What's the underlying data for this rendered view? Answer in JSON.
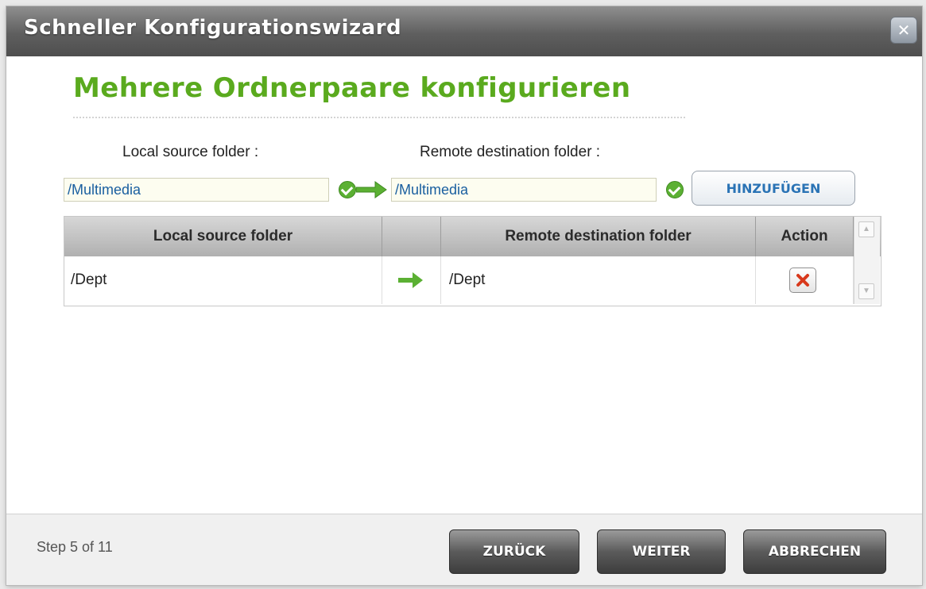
{
  "window": {
    "title": "Schneller Konfigurationswizard",
    "close_icon": "close-icon"
  },
  "page": {
    "heading": "Mehrere Ordnerpaare konfigurieren"
  },
  "form": {
    "local_label": "Local source folder :",
    "remote_label": "Remote destination folder :",
    "local_value": "/Multimedia",
    "remote_value": "/Multimedia",
    "add_button": "HINZUFÜGEN"
  },
  "table": {
    "columns": [
      "Local source folder",
      "",
      "Remote destination folder",
      "Action"
    ],
    "rows": [
      {
        "local": "/Dept",
        "remote": "/Dept",
        "action_icon": "delete-icon"
      }
    ]
  },
  "footer": {
    "step": "Step 5 of 11",
    "back": "ZURÜCK",
    "next": "WEITER",
    "cancel": "ABBRECHEN"
  },
  "colors": {
    "heading_green": "#5aaa1e",
    "link_blue": "#2a73b5",
    "check_green": "#5bb033"
  }
}
